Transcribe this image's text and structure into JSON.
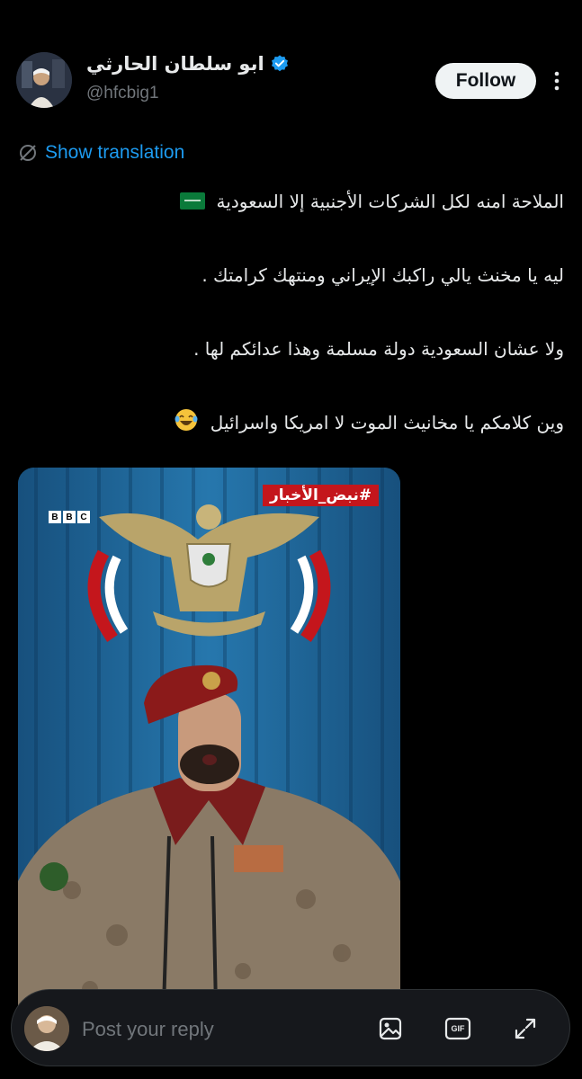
{
  "post": {
    "author": {
      "display_name": "ابو سلطان الحارثي",
      "handle": "@hfcbig1",
      "verified": true,
      "avatar_icon": "user-avatar"
    },
    "follow_label": "Follow",
    "more_icon": "more-vertical-icon",
    "show_translation_label": "Show translation",
    "lines": [
      "الملاحة امنه لكل الشركات الأجنبية إلا السعودية",
      "ليه يا مخنث يالي راكبك الإيراني ومنتهك كرامتك .",
      "ولا عشان السعودية دولة مسلمة وهذا عدائكم لها .",
      "وين كلامكم يا مخانيث الموت لا امريكا واسرائيل"
    ],
    "media": {
      "bbc_letters": [
        "B",
        "B",
        "C"
      ],
      "hashtag": "#نبض_الأخبار"
    }
  },
  "reply": {
    "placeholder": "Post your reply",
    "icons": [
      "image-icon",
      "gif-icon",
      "expand-icon"
    ],
    "gif_label": "GIF"
  },
  "colors": {
    "background": "#000000",
    "accent": "#1d9bf0",
    "text": "#e7e9ea",
    "muted": "#71767b",
    "follow_bg": "#eff3f4",
    "hashtag_bg": "#c4161c"
  }
}
